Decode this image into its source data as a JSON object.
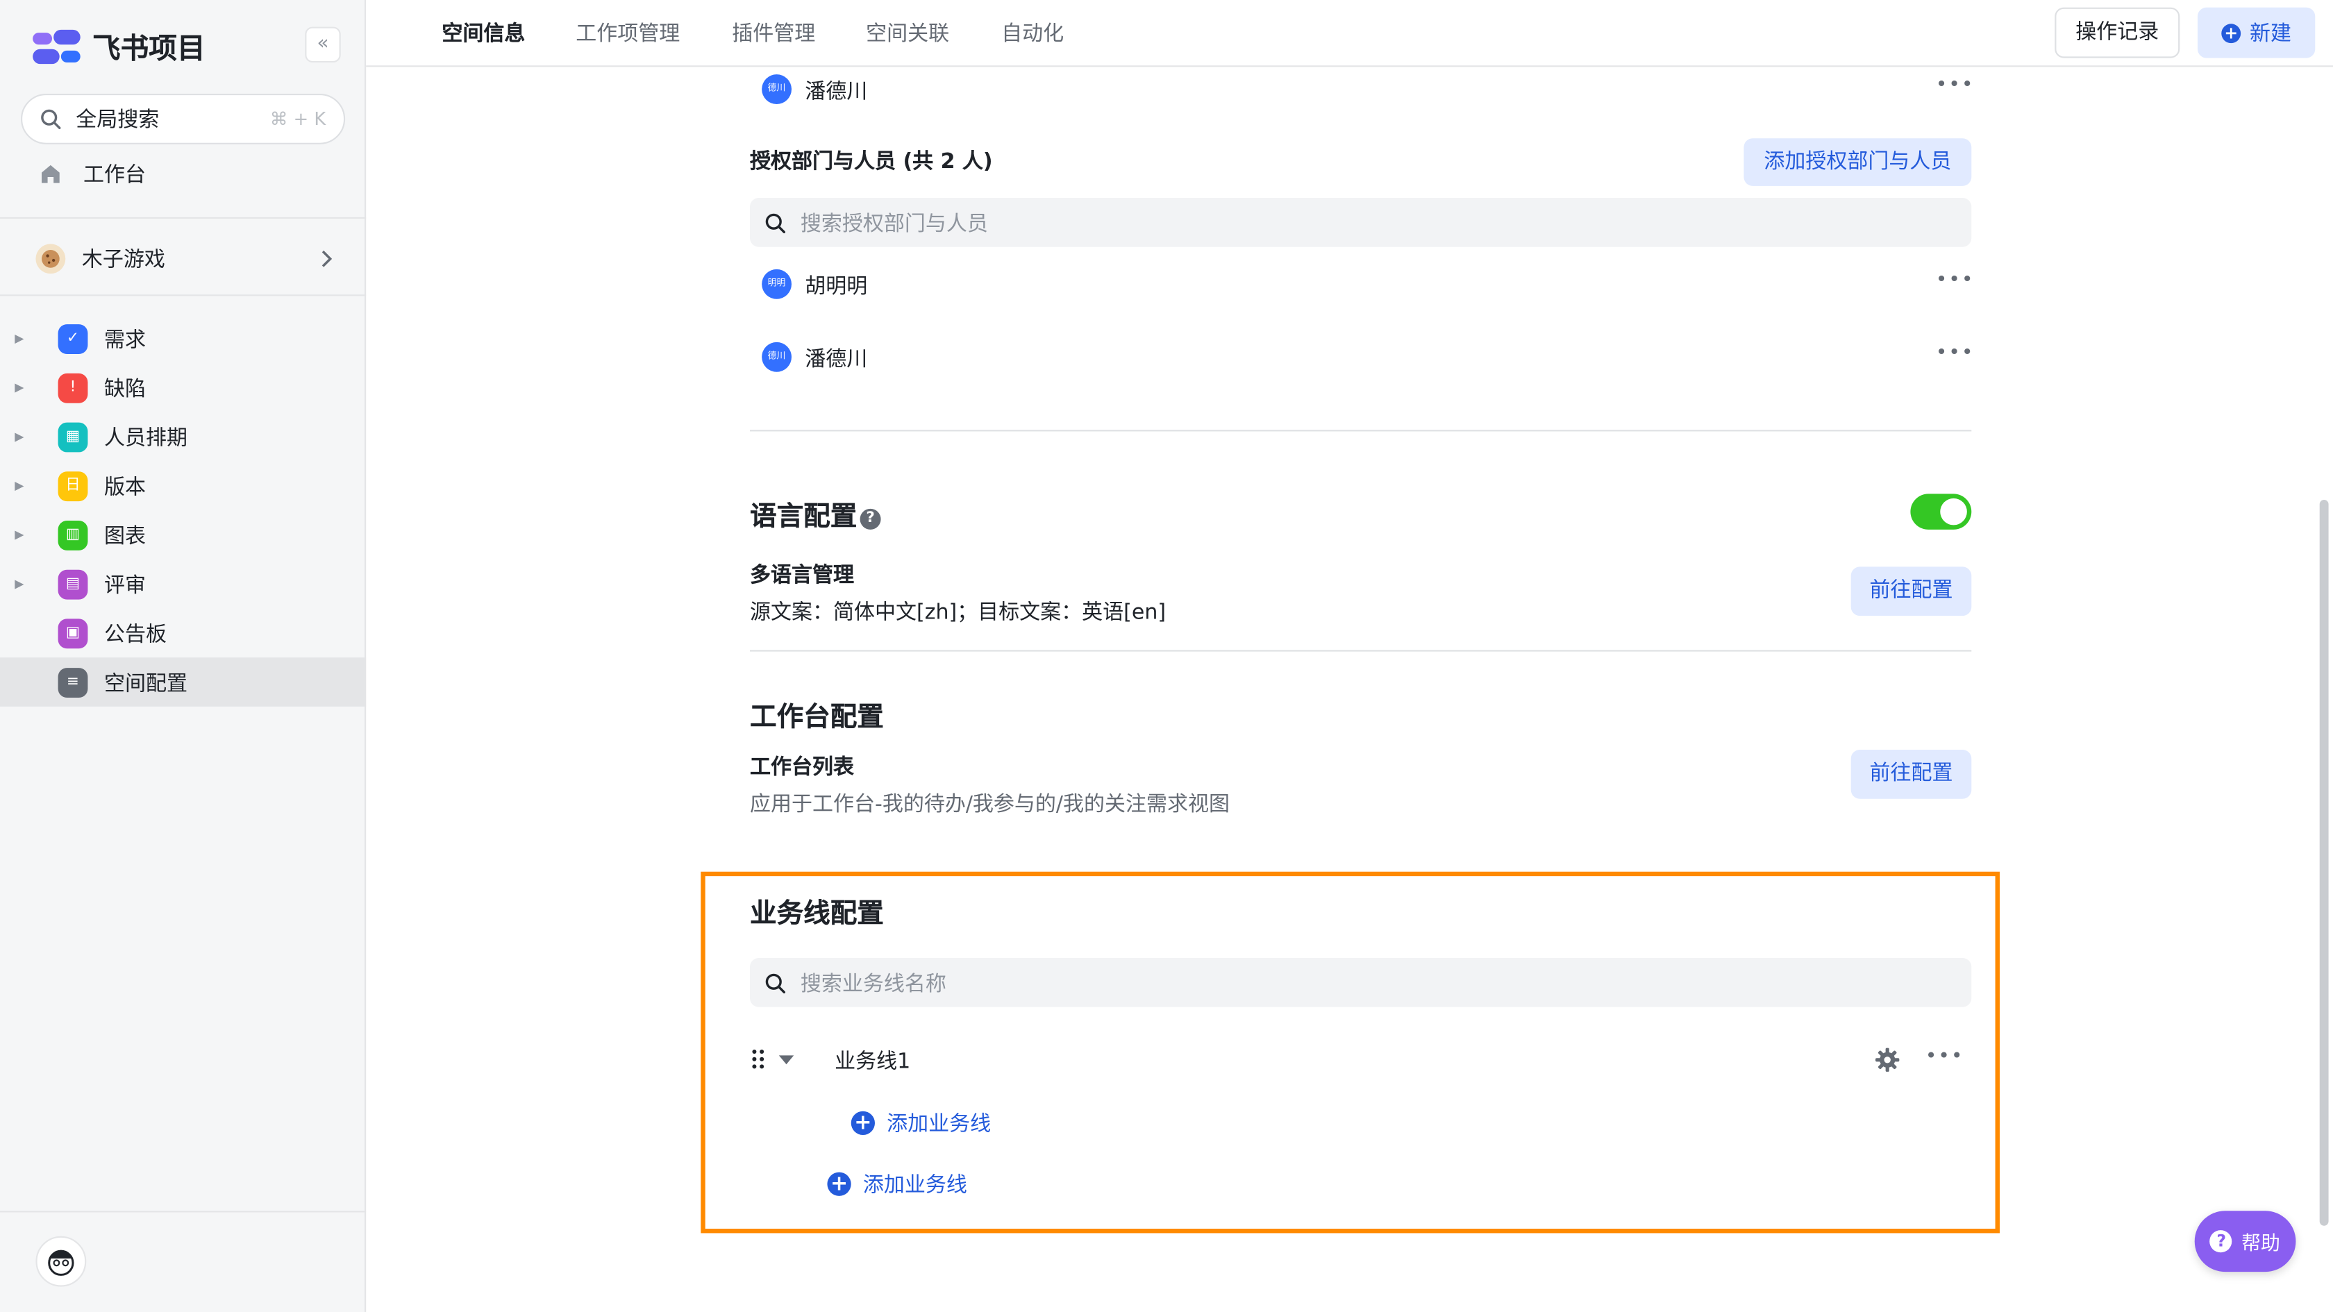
{
  "app": {
    "title": "飞书项目"
  },
  "sidebar": {
    "search_label": "全局搜索",
    "search_shortcut": "⌘ + K",
    "home_label": "工作台",
    "space_name": "木子游戏",
    "items": [
      {
        "label": "需求",
        "color": "#3370ff",
        "icon": "check-circle-icon"
      },
      {
        "label": "缺陷",
        "color": "#f54a45",
        "icon": "alert-circle-icon"
      },
      {
        "label": "人员排期",
        "color": "#14c0c0",
        "icon": "calendar-icon"
      },
      {
        "label": "版本",
        "color": "#ffc60a",
        "icon": "version-icon"
      },
      {
        "label": "图表",
        "color": "#34c724",
        "icon": "bar-chart-icon"
      },
      {
        "label": "评审",
        "color": "#b04fce",
        "icon": "review-icon"
      },
      {
        "label": "公告板",
        "color": "#b04fce",
        "icon": "bulletin-icon"
      },
      {
        "label": "空间配置",
        "color": "#646a73",
        "icon": "settings-list-icon"
      }
    ]
  },
  "tabs": [
    "空间信息",
    "工作项管理",
    "插件管理",
    "空间关联",
    "自动化"
  ],
  "toolbar": {
    "log_label": "操作记录",
    "new_label": "新建"
  },
  "authorized": {
    "top_member": {
      "name": "潘德川",
      "avatar": "德川"
    },
    "title": "授权部门与人员  (共 2 人)",
    "add_button": "添加授权部门与人员",
    "search_placeholder": "搜索授权部门与人员",
    "members": [
      {
        "name": "胡明明",
        "avatar": "明明"
      },
      {
        "name": "潘德川",
        "avatar": "德川"
      }
    ]
  },
  "language": {
    "title": "语言配置",
    "enabled": true,
    "sub_title": "多语言管理",
    "desc": "源文案：简体中文[zh]；目标文案：英语[en]",
    "button": "前往配置"
  },
  "workbench": {
    "title": "工作台配置",
    "sub_title": "工作台列表",
    "desc": "应用于工作台-我的待办/我参与的/我的关注需求视图",
    "button": "前往配置"
  },
  "business": {
    "title": "业务线配置",
    "search_placeholder": "搜索业务线名称",
    "line_name": "业务线1",
    "add_child": "添加业务线",
    "add_root": "添加业务线"
  },
  "help": {
    "label": "帮助"
  }
}
